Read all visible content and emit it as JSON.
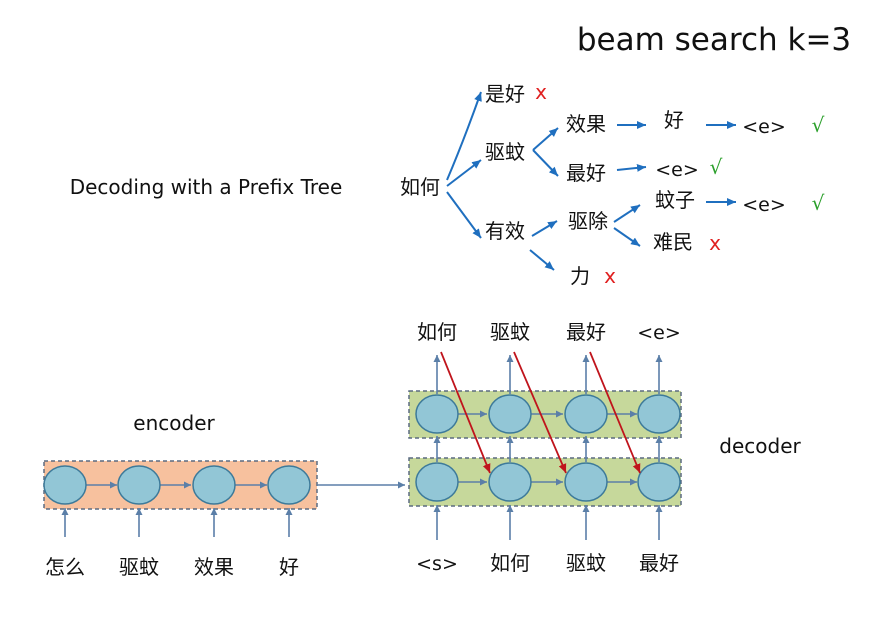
{
  "title": "beam search k=3",
  "prefix_tree_caption": "Decoding with a Prefix Tree",
  "marks": {
    "wrong": "x",
    "right": "√"
  },
  "colors": {
    "title": "#e8341c",
    "arrow_blue": "#1f6fbf",
    "wrong": "#e02020",
    "right": "#2ca02c",
    "encoder_fill": "#f7c19e",
    "decoder_fill": "#c6d89b",
    "node_fill": "#92c6d6",
    "node_stroke": "#3d7a9a",
    "skip_arrow": "#c0141c"
  },
  "tree": {
    "root": "如何",
    "n_shihao": "是好",
    "n_quwen": "驱蚊",
    "n_youxiao": "有效",
    "n_xiaoguo": "效果",
    "n_hao": "好",
    "n_e1": "<e>",
    "n_zuihao": "最好",
    "n_e2": "<e>",
    "n_quchu": "驱除",
    "n_wenzi": "蚊子",
    "n_e3": "<e>",
    "n_nanmin": "难民",
    "n_li": "力"
  },
  "encoder": {
    "label": "encoder",
    "inputs": [
      "怎么",
      "驱蚊",
      "效果",
      "好"
    ]
  },
  "decoder": {
    "label": "decoder",
    "inputs": [
      "<s>",
      "如何",
      "驱蚊",
      "最好"
    ],
    "outputs": [
      "如何",
      "驱蚊",
      "最好",
      "<e>"
    ]
  }
}
